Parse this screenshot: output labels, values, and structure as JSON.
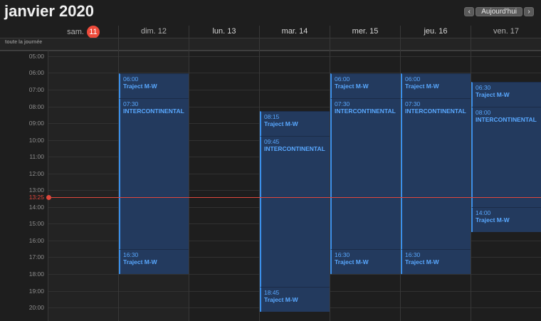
{
  "header": {
    "title": "janvier 2020",
    "prev_label": "‹",
    "today_label": "Aujourd'hui",
    "next_label": "›"
  },
  "days": [
    {
      "label": "sam.",
      "badge": "11"
    },
    {
      "label": "dim. 12"
    },
    {
      "label": "lun. 13"
    },
    {
      "label": "mar. 14"
    },
    {
      "label": "mer. 15"
    },
    {
      "label": "jeu. 16"
    },
    {
      "label": "ven. 17"
    }
  ],
  "allday_label": "toute la journée",
  "hours": [
    "05:00",
    "06:00",
    "07:00",
    "08:00",
    "09:00",
    "10:00",
    "11:00",
    "12:00",
    "13:00",
    "14:00",
    "15:00",
    "16:00",
    "17:00",
    "18:00",
    "19:00",
    "20:00"
  ],
  "now_label": "13:25",
  "events": [
    {
      "time": "06:00",
      "title": "Traject M-W"
    },
    {
      "time": "07:30",
      "title": "INTERCONTINENTAL"
    },
    {
      "time": "16:30",
      "title": "Traject M-W"
    },
    {
      "time": "08:15",
      "title": "Traject M-W"
    },
    {
      "time": "09:45",
      "title": "INTERCONTINENTAL"
    },
    {
      "time": "18:45",
      "title": "Traject M-W"
    },
    {
      "time": "06:00",
      "title": "Traject M-W"
    },
    {
      "time": "07:30",
      "title": "INTERCONTINENTAL"
    },
    {
      "time": "16:30",
      "title": "Traject M-W"
    },
    {
      "time": "06:00",
      "title": "Traject M-W"
    },
    {
      "time": "07:30",
      "title": "INTERCONTINENTAL"
    },
    {
      "time": "16:30",
      "title": "Traject M-W"
    },
    {
      "time": "06:30",
      "title": "Traject M-W"
    },
    {
      "time": "08:00",
      "title": "INTERCONTINENTAL"
    },
    {
      "time": "14:00",
      "title": "Traject M-W"
    }
  ],
  "colors": {
    "accent": "#3b8fe9",
    "event_bg": "#233a5e",
    "today": "#ee4b3b",
    "now_line": "#e0473c"
  }
}
